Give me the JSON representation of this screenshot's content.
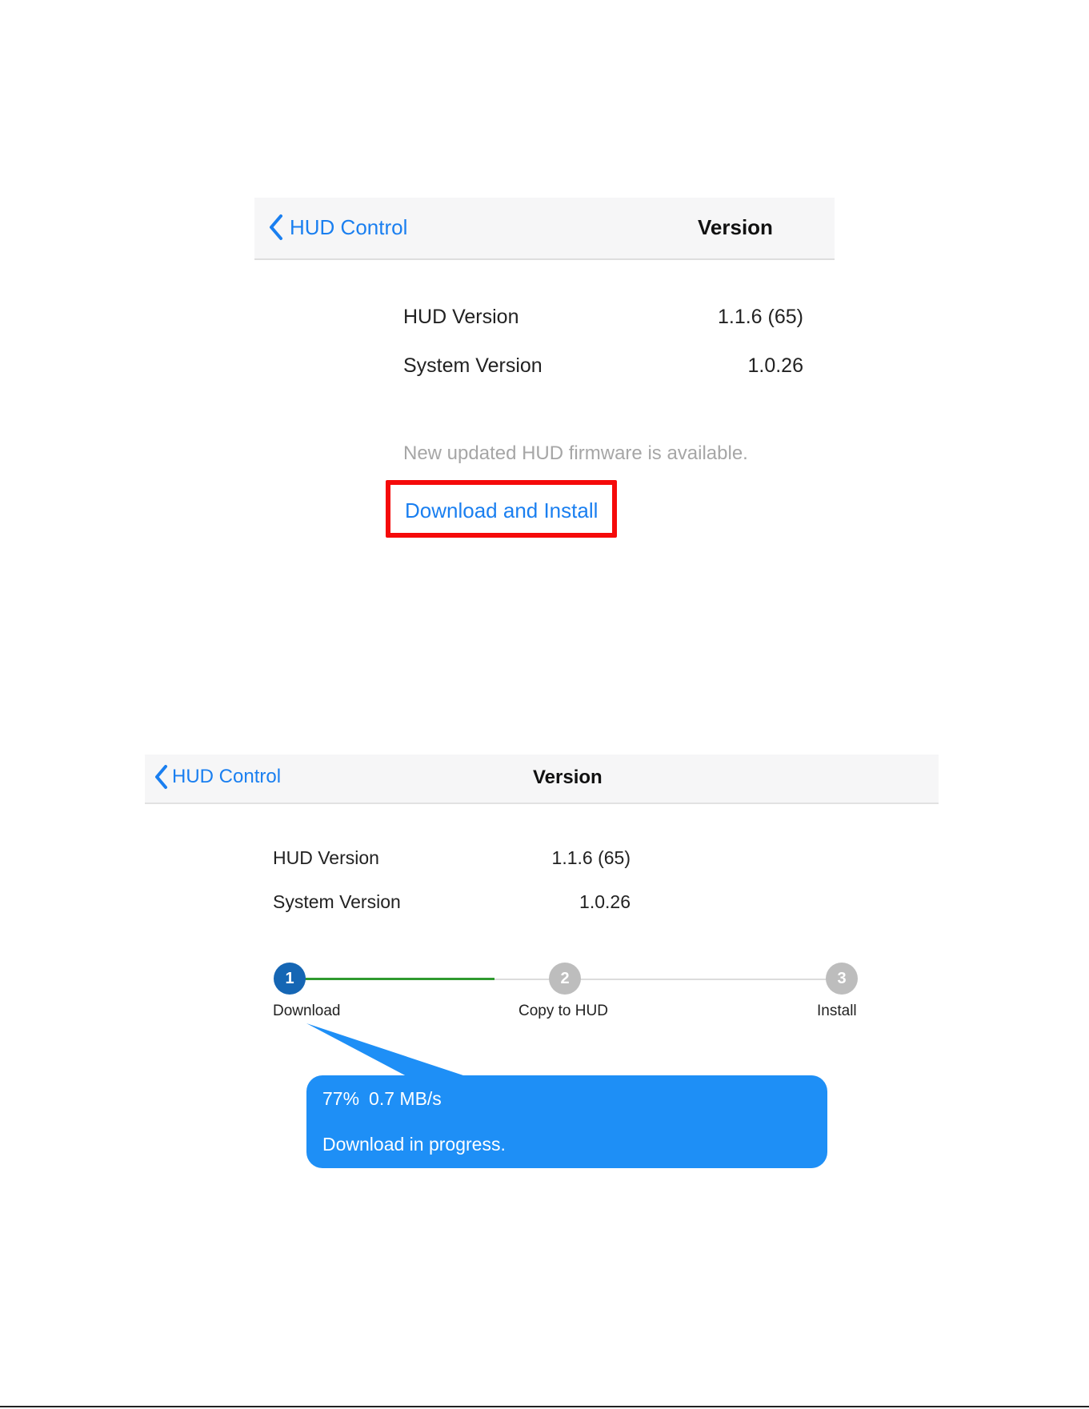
{
  "colors": {
    "accent_blue": "#1a7ff0",
    "highlight_red": "#f50a0a",
    "progress_green": "#2f9a2f",
    "step_active": "#1566b4",
    "step_inactive": "#bdbdbd",
    "bubble_blue": "#1e8ff6"
  },
  "screen1": {
    "nav": {
      "back_label": "HUD Control",
      "back_icon": "chevron-left-icon",
      "title": "Version"
    },
    "rows": [
      {
        "label": "HUD Version",
        "value": "1.1.6 (65)"
      },
      {
        "label": "System Version",
        "value": "1.0.26"
      }
    ],
    "notice": "New updated HUD firmware is available.",
    "action_label": "Download and Install"
  },
  "screen2": {
    "nav": {
      "back_label": "HUD Control",
      "back_icon": "chevron-left-icon",
      "title": "Version"
    },
    "rows": [
      {
        "label": "HUD Version",
        "value": "1.1.6 (65)"
      },
      {
        "label": "System Version",
        "value": "1.0.26"
      }
    ],
    "steps": [
      {
        "number": "1",
        "label": "Download",
        "state": "active"
      },
      {
        "number": "2",
        "label": "Copy to HUD",
        "state": "pending"
      },
      {
        "number": "3",
        "label": "Install",
        "state": "pending"
      }
    ],
    "progress": {
      "percent_text": "77%",
      "speed_text": "0.7 MB/s",
      "status_text": "Download in progress."
    }
  }
}
